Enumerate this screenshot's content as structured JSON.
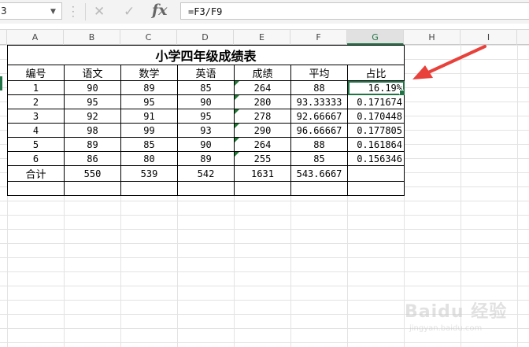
{
  "formula_bar": {
    "name_box": "3",
    "cancel_glyph": "✕",
    "enter_glyph": "✓",
    "fx_label": "fx",
    "formula": "=F3/F9"
  },
  "columns": [
    "A",
    "B",
    "C",
    "D",
    "E",
    "F",
    "G",
    "H",
    "I"
  ],
  "selected_column": "G",
  "sheet": {
    "title": "小学四年级成绩表",
    "headers": [
      "编号",
      "语文",
      "数学",
      "英语",
      "成绩",
      "平均",
      "占比"
    ],
    "rows": [
      [
        "1",
        "90",
        "89",
        "85",
        "264",
        "88",
        "16.19%"
      ],
      [
        "2",
        "95",
        "95",
        "90",
        "280",
        "93.33333",
        "0.171674"
      ],
      [
        "3",
        "92",
        "91",
        "95",
        "278",
        "92.66667",
        "0.170448"
      ],
      [
        "4",
        "98",
        "99",
        "93",
        "290",
        "96.66667",
        "0.177805"
      ],
      [
        "5",
        "89",
        "85",
        "90",
        "264",
        "88",
        "0.161864"
      ],
      [
        "6",
        "86",
        "80",
        "89",
        "255",
        "85",
        "0.156346"
      ]
    ],
    "totals": [
      "合计",
      "550",
      "539",
      "542",
      "1631",
      "543.6667",
      ""
    ],
    "blank_row": [
      "",
      "",
      "",
      "",
      "",
      "",
      ""
    ]
  },
  "annotation": {
    "arrow_color": "#e8413b"
  },
  "watermark": {
    "brand": "Baidu 经验",
    "url": "jingyan.baidu.com"
  },
  "colors": {
    "excel_green": "#217346",
    "grid": "#e3e3e3"
  }
}
